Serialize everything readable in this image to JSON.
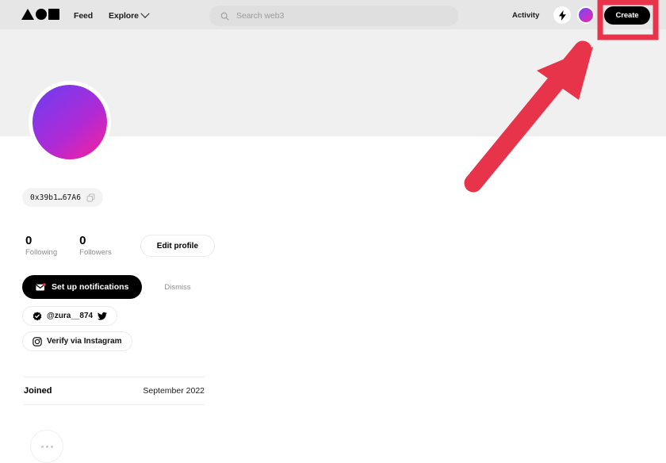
{
  "header": {
    "logo_name": "zora-logo",
    "nav": [
      {
        "label": "Feed",
        "name": "nav-feed"
      },
      {
        "label": "Explore",
        "name": "nav-explore"
      }
    ],
    "search": {
      "placeholder": "Search web3",
      "value": "",
      "icon": "search-icon"
    },
    "activity_label": "Activity",
    "bolt_icon": "lightning-bolt-icon",
    "avatar_icon": "user-avatar",
    "create_label": "Create"
  },
  "profile": {
    "avatar_name": "profile-avatar-gradient",
    "address": "0x39b1…67A6",
    "copy_icon": "copy-icon",
    "stats": [
      {
        "count": "0",
        "label": "Following"
      },
      {
        "count": "0",
        "label": "Followers"
      }
    ],
    "edit_profile_label": "Edit profile",
    "notifications": {
      "setup_label": "Set up notifications",
      "mail_icon": "mail-icon",
      "dismiss_label": "Dismiss"
    },
    "socials": [
      {
        "handle": "@zura__874",
        "lead_icon": "verified-badge-icon",
        "trail_icon": "twitter-bird-icon"
      },
      {
        "handle": "Verify via Instagram",
        "lead_icon": "instagram-icon",
        "trail_icon": ""
      }
    ],
    "joined": {
      "label": "Joined",
      "value": "September 2022"
    },
    "more_icon": "more-dots-icon"
  },
  "annotation": {
    "highlight_target": "Create",
    "highlight_color": "#e8344b",
    "arrow_color": "#e8344b"
  }
}
